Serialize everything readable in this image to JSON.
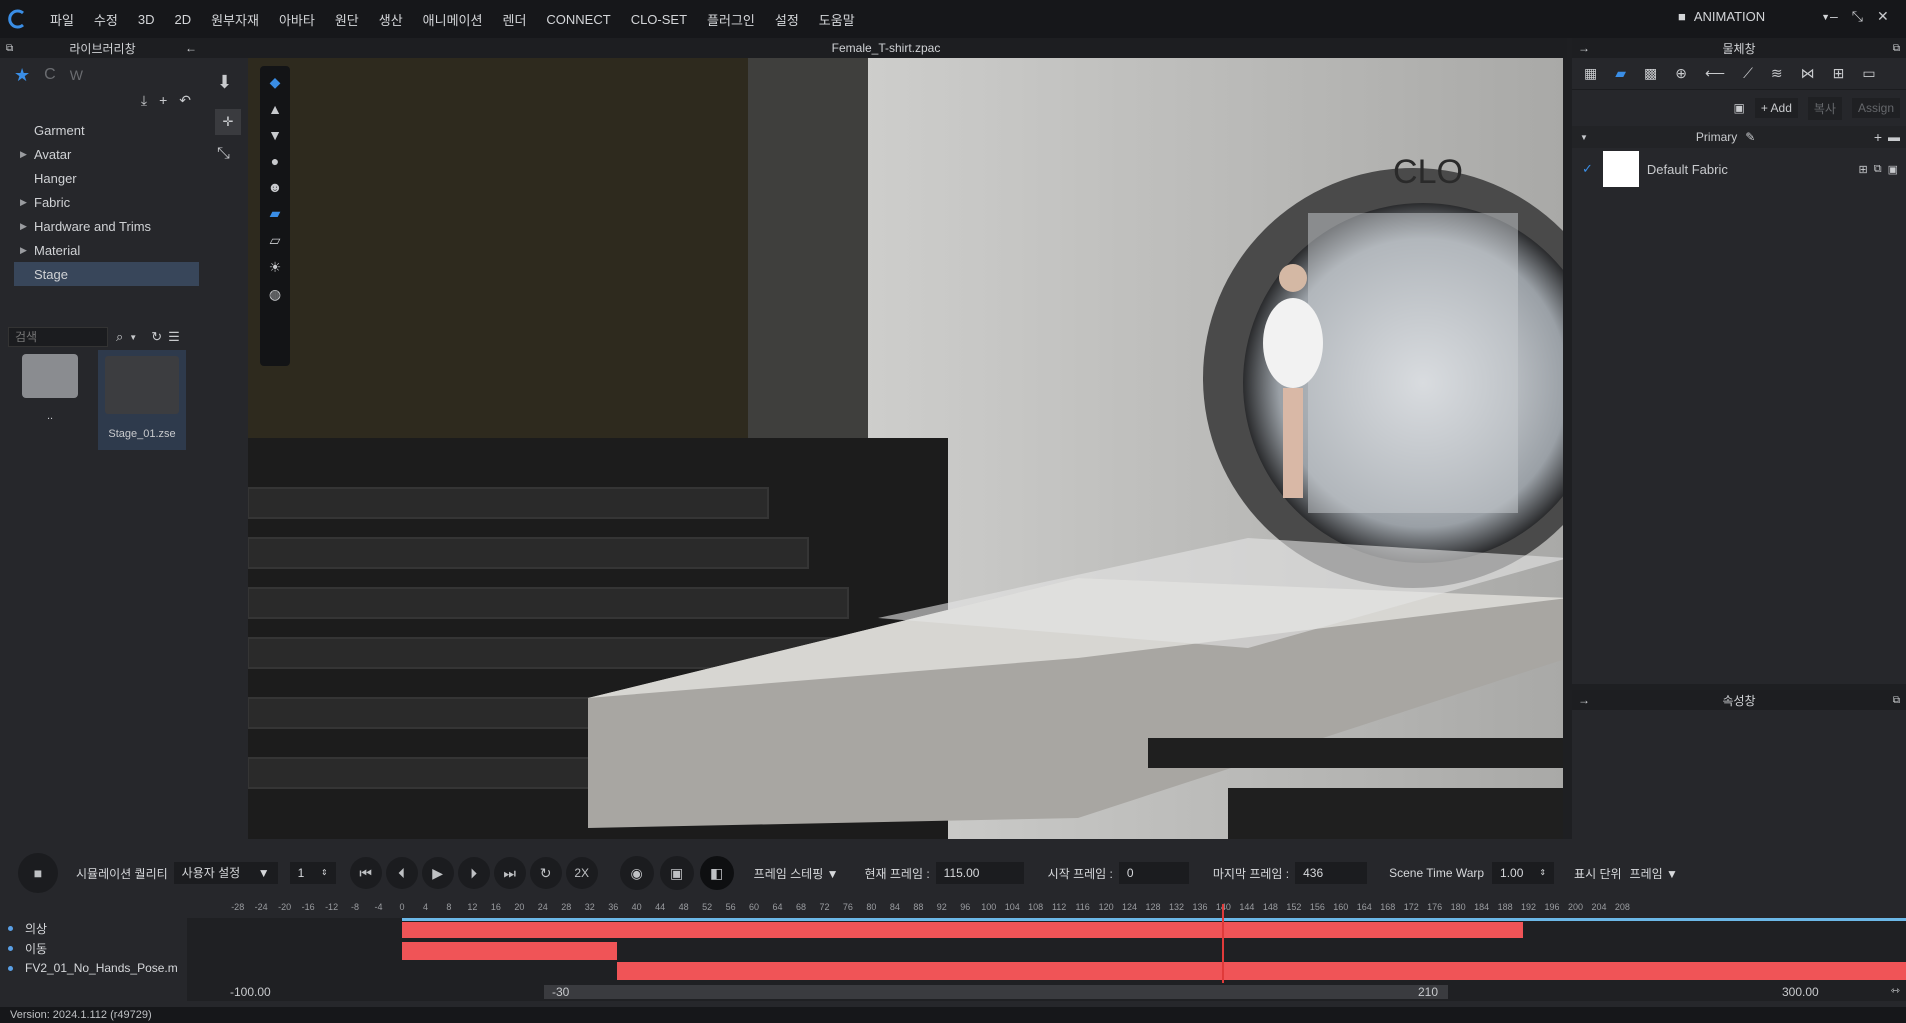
{
  "menubar": {
    "items": [
      "파일",
      "수정",
      "3D",
      "2D",
      "원부자재",
      "아바타",
      "원단",
      "생산",
      "애니메이션",
      "렌더",
      "CONNECT",
      "CLO-SET",
      "플러그인",
      "설정",
      "도움말"
    ],
    "mode_label": "ANIMATION"
  },
  "library": {
    "title": "라이브러리창",
    "tree": [
      {
        "label": "Garment",
        "expandable": false
      },
      {
        "label": "Avatar",
        "expandable": true
      },
      {
        "label": "Hanger",
        "expandable": false
      },
      {
        "label": "Fabric",
        "expandable": true
      },
      {
        "label": "Hardware and Trims",
        "expandable": true
      },
      {
        "label": "Material",
        "expandable": true
      },
      {
        "label": "Stage",
        "expandable": false,
        "selected": true
      }
    ],
    "search_placeholder": "검색",
    "files": [
      {
        "name": "..",
        "type": "folder"
      },
      {
        "name": "Stage_01.zse",
        "type": "stage"
      }
    ]
  },
  "viewport": {
    "title": "Female_T-shirt.zpac",
    "brand_text": "CLO"
  },
  "object_panel": {
    "title": "물체창",
    "add_label": "Add",
    "copy_label": "복사",
    "assign_label": "Assign",
    "group_label": "Primary",
    "fabric_name": "Default Fabric"
  },
  "property_panel": {
    "title": "속성창"
  },
  "timeline": {
    "sim_quality_label": "시뮬레이션 퀄리티",
    "sim_quality_value": "사용자 설정",
    "step_value": "1",
    "speed_label": "2X",
    "frame_stepping_label": "프레임 스테핑",
    "current_frame_label": "현재 프레임 :",
    "current_frame_value": "115.00",
    "start_frame_label": "시작 프레임 :",
    "start_frame_value": "0",
    "end_frame_label": "마지막 프레임 :",
    "end_frame_value": "436",
    "time_warp_label": "Scene Time Warp",
    "time_warp_value": "1.00",
    "display_unit_label": "표시 단위",
    "display_unit_value": "프레임",
    "ruler_ticks": [
      "-28",
      "-24",
      "-20",
      "-16",
      "-12",
      "-8",
      "-4",
      "0",
      "4",
      "8",
      "12",
      "16",
      "20",
      "24",
      "28",
      "32",
      "36",
      "40",
      "44",
      "48",
      "52",
      "56",
      "60",
      "64",
      "68",
      "72",
      "76",
      "80",
      "84",
      "88",
      "92",
      "96",
      "100",
      "104",
      "108",
      "112",
      "116",
      "120",
      "124",
      "128",
      "132",
      "136",
      "140",
      "144",
      "148",
      "152",
      "156",
      "160",
      "164",
      "168",
      "172",
      "176",
      "180",
      "184",
      "188",
      "192",
      "196",
      "200",
      "204",
      "208"
    ],
    "tracks": [
      "의상",
      "이동",
      "FV2_01_No_Hands_Pose.m"
    ],
    "range_min": "-100.00",
    "range_start": "-30",
    "range_end": "210",
    "range_max": "300.00"
  },
  "status": {
    "version": "Version: 2024.1.112 (r49729)"
  },
  "colors": {
    "accent": "#3a8ee6",
    "track_bar": "#f05457",
    "playhead": "#e03a3a"
  }
}
